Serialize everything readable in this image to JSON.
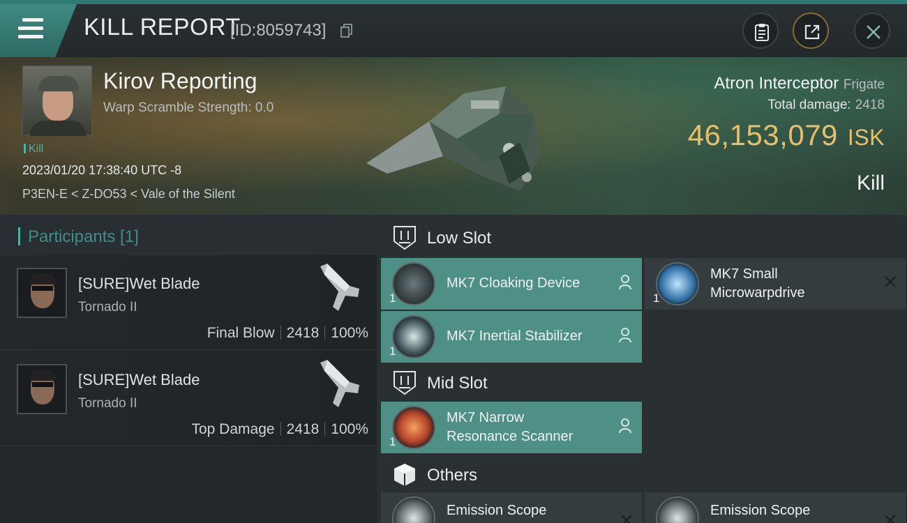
{
  "header": {
    "title": "KILL REPORT",
    "kill_id": "[ID:8059743]"
  },
  "victim": {
    "name": "Kirov Reporting",
    "warp_scramble": "Warp Scramble Strength: 0.0",
    "kill_tag": "Kill",
    "time": "2023/01/20 17:38:40 UTC -8",
    "location": "P3EN-E < Z-DO53 < Vale of the Silent"
  },
  "ship": {
    "name": "Atron Interceptor",
    "class": "Frigate",
    "total_damage_label": "Total damage:",
    "total_damage": "2418",
    "isk_value": "46,153,079",
    "isk_unit": "ISK",
    "result": "Kill"
  },
  "participants": {
    "label": "Participants [1]",
    "rows": [
      {
        "name": "[SURE]Wet Blade",
        "ship": "Tornado II",
        "role": "Final Blow",
        "damage": "2418",
        "percent": "100%"
      },
      {
        "name": "[SURE]Wet Blade",
        "ship": "Tornado II",
        "role": "Top Damage",
        "damage": "2418",
        "percent": "100%"
      }
    ]
  },
  "fitting": {
    "low_slot": {
      "label": "Low Slot",
      "items": [
        {
          "name_line1": "MK7 Cloaking Device",
          "name_line2": "",
          "qty": "1",
          "icon": "cloaking-device-icon"
        },
        {
          "name_line1": "MK7 Small",
          "name_line2": "Microwarpdrive",
          "qty": "1",
          "icon": "microwarpdrive-icon"
        },
        {
          "name_line1": "MK7 Inertial Stabilizer",
          "name_line2": "",
          "qty": "1",
          "icon": "inertial-stabilizer-icon"
        }
      ]
    },
    "mid_slot": {
      "label": "Mid Slot",
      "items": [
        {
          "name_line1": "MK7 Narrow",
          "name_line2": "Resonance Scanner",
          "qty": "1",
          "icon": "resonance-scanner-icon"
        }
      ]
    },
    "others": {
      "label": "Others",
      "items": [
        {
          "name_line1": "Emission Scope",
          "icon": "emission-scope-icon"
        },
        {
          "name_line1": "Emission Scope",
          "icon": "emission-scope-icon"
        }
      ]
    }
  },
  "colors": {
    "accent": "#4fb0a6",
    "isk": "#e8bf6a",
    "module_highlight": "#4e8f86"
  }
}
